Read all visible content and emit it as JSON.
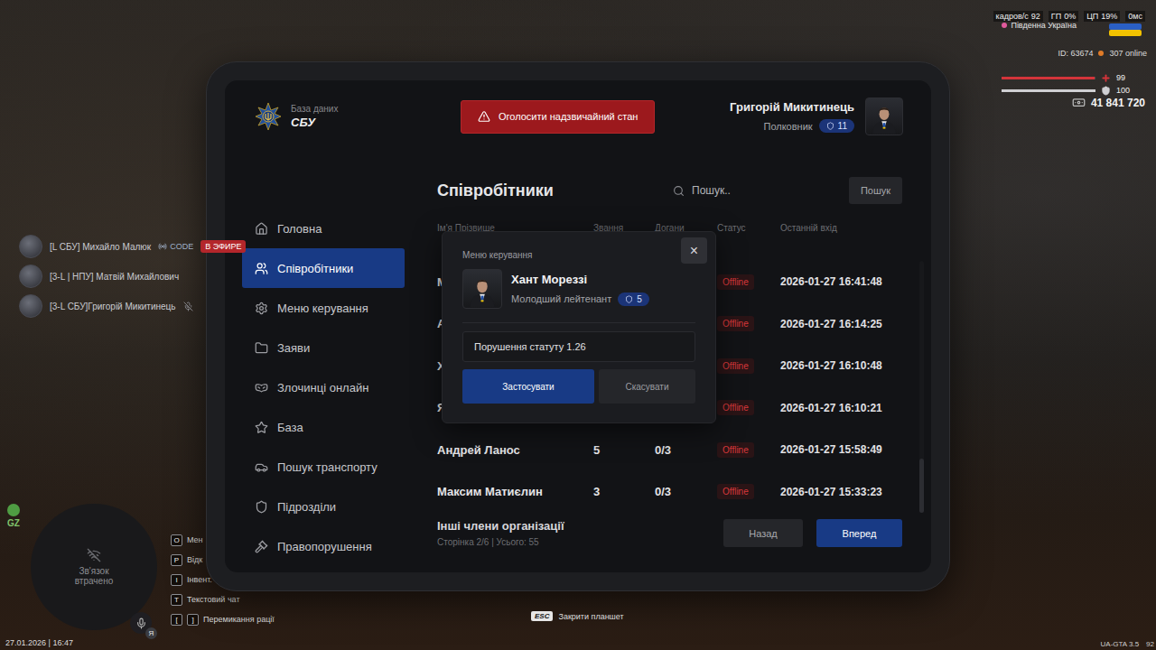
{
  "hud": {
    "perf": [
      {
        "label": "кадров/с",
        "value": "92"
      },
      {
        "label": "ГП",
        "value": "0%"
      },
      {
        "label": "ЦП",
        "value": "19%"
      },
      {
        "label": "",
        "value": "0мс"
      }
    ],
    "region": "Південна Україна",
    "player_id": "ID: 63674",
    "online": "307 online",
    "health": {
      "value": "99",
      "level": 0.99
    },
    "armor": {
      "value": "100",
      "level": 1
    },
    "money": "41 841 720",
    "voice": [
      {
        "name": "[L СБУ] Михайло Малюк",
        "tag": "CODE",
        "live": "В ЭФИРЕ",
        "muted": false
      },
      {
        "name": "[3-L | НПУ] Матвій Михайлович",
        "muted": false
      },
      {
        "name": "[3-L СБУ]Григорій Микитинець",
        "muted": true
      }
    ],
    "minimap": {
      "status": "Зв'язок втрачено",
      "zone": "GZ"
    },
    "mic_badge": "Я",
    "datetime": "27.01.2026 | 16:47",
    "hints": [
      {
        "keys": [
          "O"
        ],
        "label": "Мен"
      },
      {
        "keys": [
          "P"
        ],
        "label": "Відк"
      },
      {
        "keys": [
          "I"
        ],
        "label": "Інвент."
      },
      {
        "keys": [
          "T"
        ],
        "label": "Текстовий чат"
      },
      {
        "keys": [
          "[",
          "]"
        ],
        "label": "Перемикання рації"
      }
    ],
    "close_hint": {
      "key": "ESC",
      "label": "Закрити планшет"
    },
    "version": "UA-GTA 3.5",
    "fps": "92"
  },
  "tablet": {
    "brand": {
      "caption": "База даних",
      "title": "СБУ"
    },
    "emergency_button": "Оголосити надзвичайний стан",
    "user": {
      "name": "Григорій Микитинець",
      "rank": "Полковник",
      "level": "11"
    },
    "sidebar": {
      "items": [
        {
          "label": "Головна",
          "selected": false
        },
        {
          "label": "Співробітники",
          "selected": true
        },
        {
          "label": "Меню керування",
          "selected": false
        },
        {
          "label": "Заяви",
          "selected": false
        },
        {
          "label": "Злочинці онлайн",
          "selected": false
        },
        {
          "label": "База",
          "selected": false
        },
        {
          "label": "Пошук транспорту",
          "selected": false
        },
        {
          "label": "Підрозділи",
          "selected": false
        },
        {
          "label": "Правопорушення",
          "selected": false
        }
      ]
    },
    "page_title": "Співробітники",
    "search": {
      "placeholder": "Пошук..",
      "button": "Пошук"
    },
    "table": {
      "columns": [
        "Ім'я Прізвище",
        "Звання",
        "Догани",
        "Статус",
        "Останній вхід"
      ],
      "rows": [
        {
          "name": "М",
          "rank": "",
          "warnings": "",
          "status": "Offline",
          "last_login": "2026-01-27 16:41:48"
        },
        {
          "name": "А",
          "rank": "",
          "warnings": "",
          "status": "Offline",
          "last_login": "2026-01-27 16:14:25"
        },
        {
          "name": "Х",
          "rank": "",
          "warnings": "",
          "status": "Offline",
          "last_login": "2026-01-27 16:10:48"
        },
        {
          "name": "Я",
          "rank": "",
          "warnings": "",
          "status": "Offline",
          "last_login": "2026-01-27 16:10:21"
        },
        {
          "name": "Андрей Ланос",
          "rank": "5",
          "warnings": "0/3",
          "status": "Offline",
          "last_login": "2026-01-27 15:58:49"
        },
        {
          "name": "Максим Матиєлин",
          "rank": "3",
          "warnings": "0/3",
          "status": "Offline",
          "last_login": "2026-01-27 15:33:23"
        }
      ],
      "scroll": {
        "level": 1
      }
    },
    "footer": {
      "title": "Інші члени організації",
      "page_info": "Сторінка 2/6 | Усього: 55",
      "prev": "Назад",
      "next": "Вперед"
    },
    "modal": {
      "title": "Меню керування",
      "close": "×",
      "member": {
        "name": "Хант Мореззі",
        "rank": "Молодший лейтенант",
        "level": "5"
      },
      "reason": "Порушення статуту 1.26",
      "apply": "Застосувати",
      "cancel": "Скасувати"
    }
  }
}
